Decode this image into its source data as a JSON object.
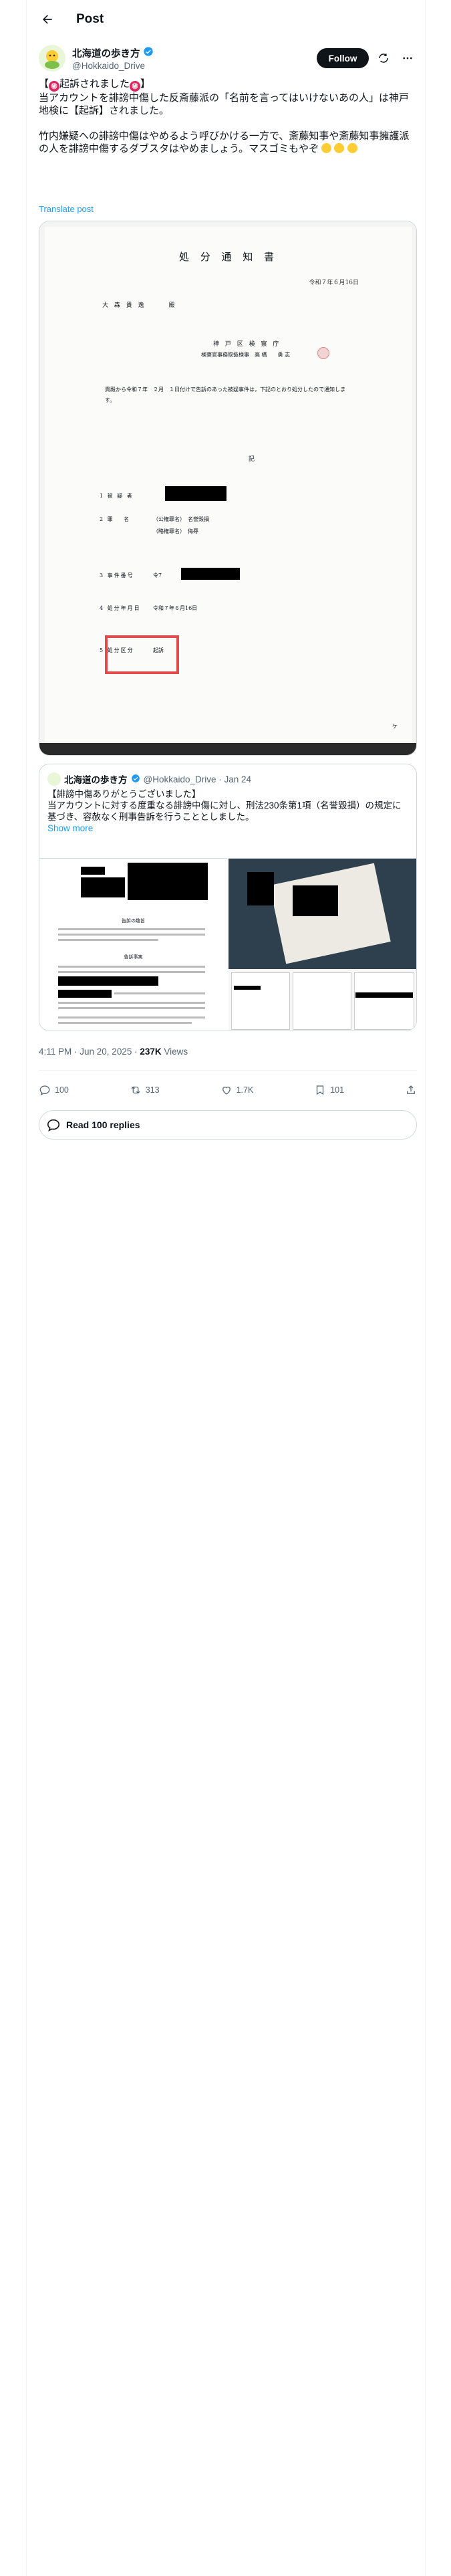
{
  "header": {
    "title": "Post"
  },
  "author": {
    "name": "北海道の歩き方",
    "handle": "@Hokkaido_Drive",
    "follow_label": "Follow"
  },
  "post": {
    "line1_pre": "【",
    "line1_mid": "起訴されました",
    "line1_post": "】",
    "line2": "当アカウントを誹謗中傷した反斎藤派の「名前を言ってはいけないあの人」は神戸地検に【起訴】されました。",
    "line3": "竹内嫌疑への誹謗中傷はやめるよう呼びかける一方で、斎藤知事や斎藤知事擁護派の人を誹謗中傷するダブスタはやめましょう。マスゴミもやぞ",
    "translate": "Translate post"
  },
  "document": {
    "title": "処 分 通 知 書",
    "date": "令和７年６月16日",
    "addressee": "大 森 貴 逸",
    "addressee_suffix": "殿",
    "office": "神 戸 区 検 察 庁",
    "prosecutor": "検察官事務取扱検事　高 橋　　勇 志",
    "body": "貴殿から令和７年　２月　１日付けで告訴のあった被疑事件は，下記のとおり処分したので通知します。",
    "ki": "記",
    "rows": [
      {
        "label": "1 被 疑 者",
        "value": ""
      },
      {
        "label": "2 罪　 名",
        "value": "（公権罪名）　名誉毀損"
      },
      {
        "label": "",
        "value": "（略権罪名）　侮辱"
      },
      {
        "label": "3 事件番号",
        "value": "令7"
      },
      {
        "label": "4 処分年月日",
        "value": "令和７年６月16日"
      },
      {
        "label": "5 処分区分",
        "value": "起訴"
      }
    ],
    "footer_mark": "ケ"
  },
  "quoted": {
    "name": "北海道の歩き方",
    "meta": "@Hokkaido_Drive · Jan 24",
    "text1": "【誹謗中傷ありがとうございました】",
    "text2": "当アカウントに対する度重なる誹謗中傷に対し、刑法230条第1項（名誉毀損）の規定に基づき、容赦なく刑事告訴を行うこととしました。",
    "show_more": "Show more",
    "img1_title": "告訴の趣旨",
    "img1_sub": "告訴事実"
  },
  "meta": {
    "time": "4:11 PM · Jun 20, 2025 · ",
    "views_count": "237K",
    "views_label": " Views"
  },
  "actions": {
    "replies": "100",
    "reposts": "313",
    "likes": "1.7K",
    "bookmarks": "101"
  },
  "read_replies": "Read 100 replies"
}
